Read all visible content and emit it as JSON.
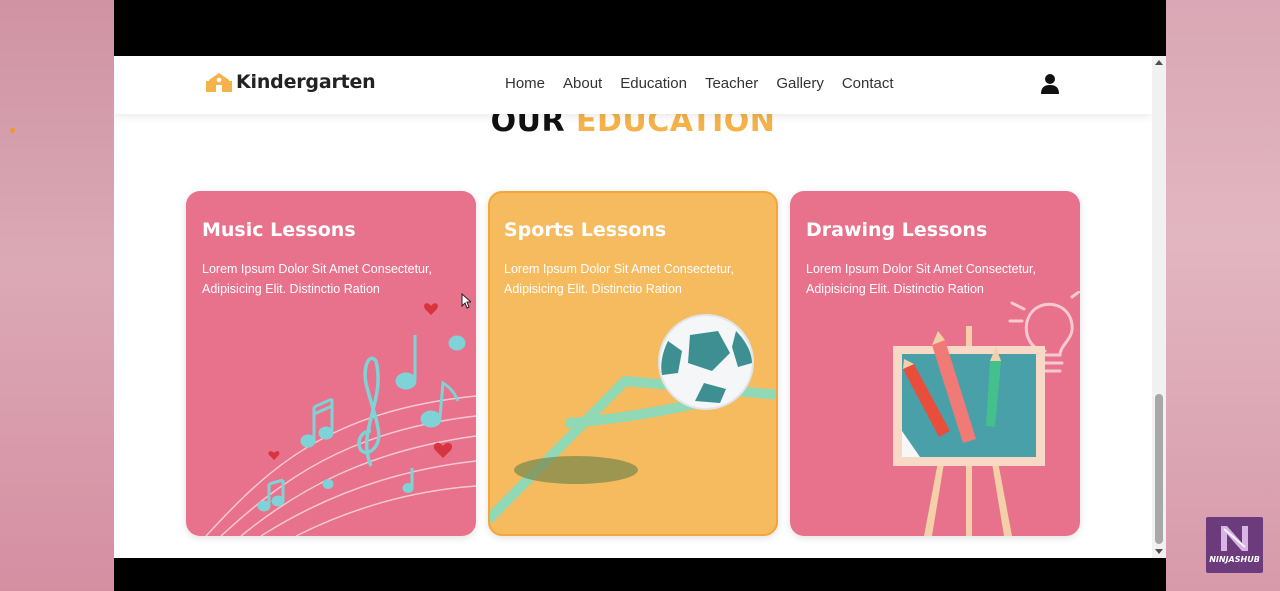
{
  "brand": {
    "name": "Kindergarten"
  },
  "nav": {
    "links": [
      "Home",
      "About",
      "Education",
      "Teacher",
      "Gallery",
      "Contact"
    ]
  },
  "section": {
    "title_part1": "OUR",
    "title_part2": "EDUCATION"
  },
  "cards": [
    {
      "title": "Music Lessons",
      "text": "Lorem Ipsum Dolor Sit Amet Consectetur, Adipisicing Elit. Distinctio Ration",
      "color": "#e8718b"
    },
    {
      "title": "Sports Lessons",
      "text": "Lorem Ipsum Dolor Sit Amet Consectetur, Adipisicing Elit. Distinctio Ration",
      "color": "#f6bb5e"
    },
    {
      "title": "Drawing Lessons",
      "text": "Lorem Ipsum Dolor Sit Amet Consectetur, Adipisicing Elit. Distinctio Ration",
      "color": "#e8718b"
    }
  ],
  "colors": {
    "accent": "#f5b24a",
    "card_pink": "#e8718b",
    "card_yellow": "#f6bb5e"
  },
  "overlay": {
    "badge_text": "NINJASHUB"
  }
}
